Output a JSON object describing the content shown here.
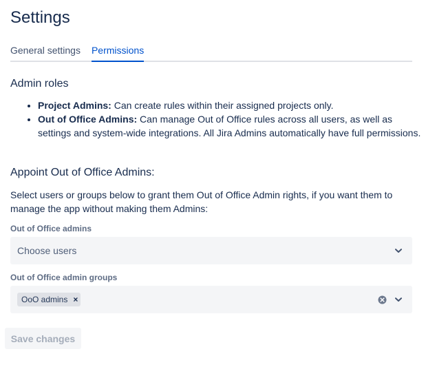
{
  "page": {
    "title": "Settings"
  },
  "tabs": [
    {
      "label": "General settings",
      "active": false
    },
    {
      "label": "Permissions",
      "active": true
    }
  ],
  "admin_roles": {
    "heading": "Admin roles",
    "items": [
      {
        "term": "Project Admins:",
        "text": " Can create rules within their assigned projects only."
      },
      {
        "term": "Out of Office Admins:",
        "text": " Can manage Out of Office rules across all users, as well as settings and system-wide integrations. All Jira Admins automatically have full permissions."
      }
    ]
  },
  "appoint": {
    "heading": "Appoint Out of Office Admins:",
    "description": "Select users or groups below to grant them Out of Office Admin rights, if you want them to manage the app without making them Admins:"
  },
  "admins_field": {
    "label": "Out of Office admins",
    "placeholder": "Choose users",
    "icon": "chevron-down-icon"
  },
  "groups_field": {
    "label": "Out of Office admin groups",
    "tags": [
      {
        "label": "OoO admins",
        "remove_glyph": "×"
      }
    ],
    "clear_icon": "clear-icon",
    "icon": "chevron-down-icon"
  },
  "actions": {
    "save_label": "Save changes",
    "save_disabled": true
  },
  "colors": {
    "accent": "#0052cc",
    "text": "#172b4d",
    "muted_label": "#5e6c84",
    "field_bg": "#f4f5f7",
    "disabled_text": "#a5adba"
  }
}
